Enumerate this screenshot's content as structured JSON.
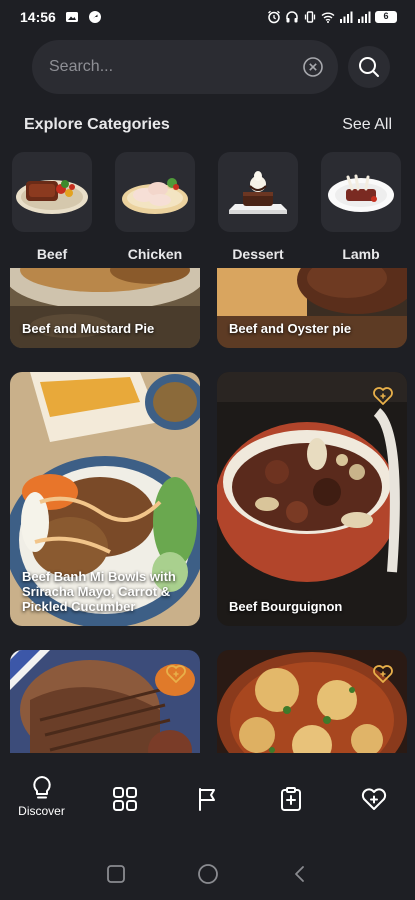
{
  "status_bar": {
    "time": "14:56",
    "battery": "6"
  },
  "search": {
    "placeholder": "Search..."
  },
  "categories_section": {
    "title": "Explore Categories",
    "see_all": "See All",
    "items": [
      {
        "label": "Beef"
      },
      {
        "label": "Chicken"
      },
      {
        "label": "Dessert"
      },
      {
        "label": "Lamb"
      }
    ]
  },
  "recipes": [
    {
      "title": "Beef and Mustard Pie"
    },
    {
      "title": "Beef and Oyster pie"
    },
    {
      "title": "Beef Banh Mi Bowls with Sriracha Mayo, Carrot & Pickled Cucumber"
    },
    {
      "title": "Beef Bourguignon"
    },
    {
      "title": ""
    },
    {
      "title": ""
    }
  ],
  "bottom_nav": {
    "discover_label": "Discover"
  },
  "colors": {
    "background": "#1e1f24",
    "surface": "#2b2c32",
    "accent_heart": "#e8b04a"
  }
}
